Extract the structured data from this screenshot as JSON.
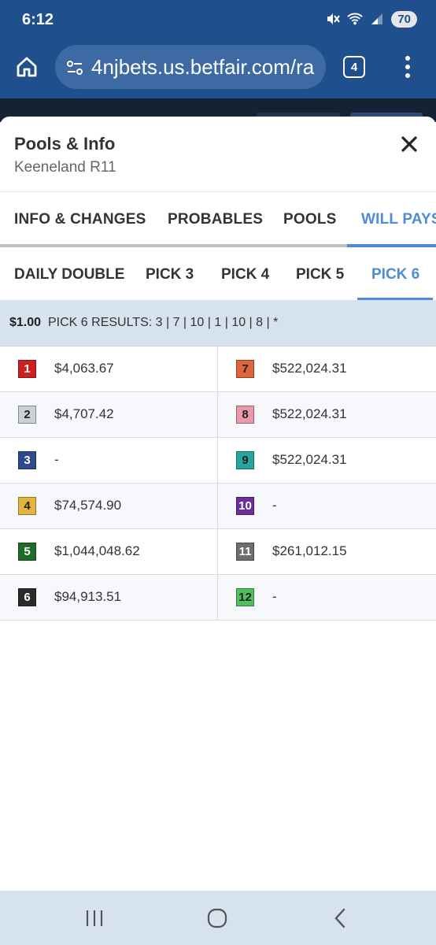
{
  "status_bar": {
    "time": "6:12",
    "battery": "70"
  },
  "browser": {
    "url": "4njbets.us.betfair.com/ra",
    "tab_count": "4"
  },
  "modal": {
    "title": "Pools & Info",
    "subtitle": "Keeneland R11"
  },
  "main_tabs": [
    {
      "label": "INFO & CHANGES"
    },
    {
      "label": "PROBABLES"
    },
    {
      "label": "POOLS"
    },
    {
      "label": "WILL PAYS",
      "active": true
    }
  ],
  "sub_tabs": [
    {
      "label": "DAILY DOUBLE"
    },
    {
      "label": "PICK 3"
    },
    {
      "label": "PICK 4"
    },
    {
      "label": "PICK 5"
    },
    {
      "label": "PICK 6",
      "active": true
    }
  ],
  "results": {
    "amount": "$1.00",
    "text": "PICK 6 RESULTS: 3 | 7 | 10 | 1 | 10 | 8 | *"
  },
  "payouts": [
    {
      "number": "1",
      "amount": "$4,063.67",
      "bg": "#cc1f1f",
      "fg": "#ffffff"
    },
    {
      "number": "2",
      "amount": "$4,707.42",
      "bg": "#c9d3d6",
      "fg": "#222222"
    },
    {
      "number": "3",
      "amount": "-",
      "bg": "#2c4a8c",
      "fg": "#ffffff"
    },
    {
      "number": "4",
      "amount": "$74,574.90",
      "bg": "#e3b53c",
      "fg": "#222222"
    },
    {
      "number": "5",
      "amount": "$1,044,048.62",
      "bg": "#1e6b2a",
      "fg": "#ffffff"
    },
    {
      "number": "6",
      "amount": "$94,913.51",
      "bg": "#2a2a2a",
      "fg": "#ffffff"
    },
    {
      "number": "7",
      "amount": "$522,024.31",
      "bg": "#e0643a",
      "fg": "#222222"
    },
    {
      "number": "8",
      "amount": "$522,024.31",
      "bg": "#e89aab",
      "fg": "#222222"
    },
    {
      "number": "9",
      "amount": "$522,024.31",
      "bg": "#27a6a0",
      "fg": "#222222"
    },
    {
      "number": "10",
      "amount": "-",
      "bg": "#6b2f9b",
      "fg": "#ffffff"
    },
    {
      "number": "11",
      "amount": "$261,012.15",
      "bg": "#6e6e6e",
      "fg": "#ffffff"
    },
    {
      "number": "12",
      "amount": "-",
      "bg": "#4fbf60",
      "fg": "#222222"
    }
  ]
}
